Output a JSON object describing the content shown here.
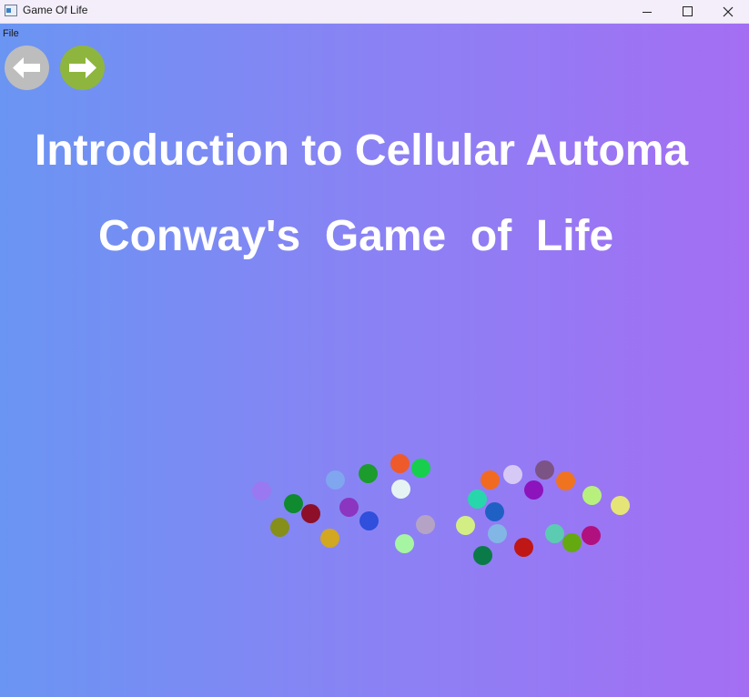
{
  "window": {
    "title": "Game Of Life",
    "controls": {
      "minimize": "minimize-icon",
      "maximize": "maximize-icon",
      "close": "close-icon"
    }
  },
  "menu": {
    "file_label": "File"
  },
  "nav": {
    "back": {
      "icon": "arrow-left-icon",
      "color": "#bdbdbd"
    },
    "forward": {
      "icon": "arrow-right-icon",
      "color": "#8eb63e"
    }
  },
  "slide": {
    "heading": "Introduction to Cellular Automa",
    "subheading": "Conway's  Game  of  Life",
    "background_colors": [
      "#6a95f3",
      "#a46ef3"
    ]
  },
  "particles": {
    "colors": [
      "#9a78f2",
      "#0f8a2f",
      "#858f1a",
      "#8e1028",
      "#7fa6ee",
      "#d2a722",
      "#8c35c0",
      "#1b9c2d",
      "#2f4fdc",
      "#ef5a2a",
      "#e5f4f3",
      "#17cf4c",
      "#b5a3c6",
      "#a6f5a2",
      "#d3ef84",
      "#27d7ab",
      "#f06b21",
      "#1f60c4",
      "#d7c9f5",
      "#0b7a49",
      "#82b6e4",
      "#8d13bd",
      "#7b5385",
      "#bf1715",
      "#f0731f",
      "#5bcbb2",
      "#65a911",
      "#b8f07e",
      "#b1117f",
      "#e5e577"
    ]
  }
}
